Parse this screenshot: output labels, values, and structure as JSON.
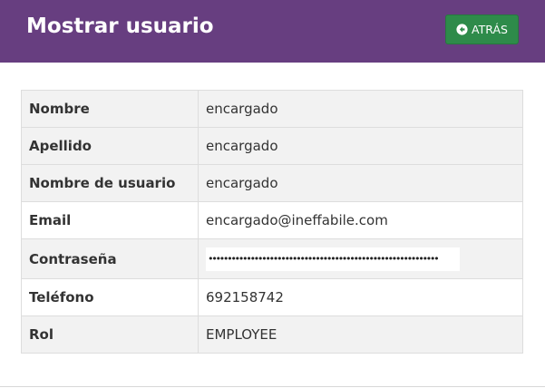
{
  "header": {
    "title": "Mostrar usuario",
    "back_label": "ATRÁS"
  },
  "user": {
    "rows": [
      {
        "label": "Nombre",
        "value": "encargado"
      },
      {
        "label": "Apellido",
        "value": "encargado"
      },
      {
        "label": "Nombre de usuario",
        "value": "encargado"
      },
      {
        "label": "Email",
        "value": "encargado@ineffabile.com"
      },
      {
        "label": "Contraseña",
        "value": "••••••••••••••••••••••••••••••••••••••••••••••••••••••••••••"
      },
      {
        "label": "Teléfono",
        "value": "692158742"
      },
      {
        "label": "Rol",
        "value": "EMPLOYEE"
      }
    ]
  },
  "colors": {
    "header_bg": "#673e80",
    "back_button_bg": "#2e8b4a"
  },
  "icons": {
    "back": "arrow-circle-left-icon"
  }
}
